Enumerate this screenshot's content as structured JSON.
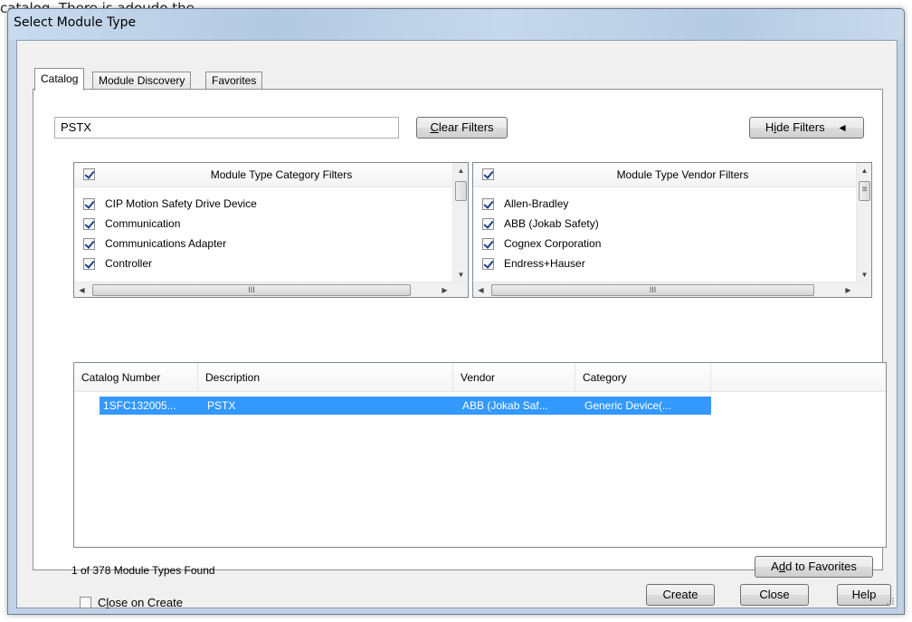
{
  "background_text": "catalog. There is adoudo the.",
  "window": {
    "title": "Select Module Type"
  },
  "tabs": [
    {
      "label": "Catalog",
      "active": true
    },
    {
      "label": "Module Discovery",
      "active": false
    },
    {
      "label": "Favorites",
      "active": false
    }
  ],
  "search": {
    "value": "PSTX"
  },
  "buttons": {
    "clear_filters_u": "C",
    "clear_filters_rest": "lear Filters",
    "hide_filters_pre": "H",
    "hide_filters_u": "i",
    "hide_filters_rest": "de Filters",
    "hide_filters_icon": "»",
    "add_favorites_pre": "A",
    "add_favorites_u": "d",
    "add_favorites_rest": "d to Favorites",
    "create": "Create",
    "close": "Close",
    "help": "Help"
  },
  "category_filters": {
    "header": "Module Type Category Filters",
    "items": [
      {
        "label": "CIP Motion Safety Drive Device",
        "checked": true
      },
      {
        "label": "Communication",
        "checked": true
      },
      {
        "label": "Communications Adapter",
        "checked": true
      },
      {
        "label": "Controller",
        "checked": true
      }
    ]
  },
  "vendor_filters": {
    "header": "Module Type Vendor Filters",
    "items": [
      {
        "label": "Allen-Bradley",
        "checked": true
      },
      {
        "label": "ABB (Jokab Safety)",
        "checked": true
      },
      {
        "label": "Cognex Corporation",
        "checked": true
      },
      {
        "label": "Endress+Hauser",
        "checked": true
      }
    ]
  },
  "scroll_glyphs": {
    "up": "▲",
    "down": "▼",
    "left": "◀",
    "right": "▶",
    "thumb_h": "III",
    "thumb_v": "≡"
  },
  "results": {
    "columns": [
      "Catalog Number",
      "Description",
      "Vendor",
      "Category"
    ],
    "rows": [
      {
        "catalog": "1SFC132005...",
        "description": "PSTX",
        "vendor": "ABB (Jokab Saf...",
        "category": "Generic Device(...",
        "selected": true
      }
    ]
  },
  "status": "1 of 378 Module Types Found",
  "close_on_create": {
    "pre": "C",
    "u": "l",
    "rest": "ose on Create",
    "checked": false
  },
  "colors": {
    "selection": "#3399ff",
    "panel": "#f0f0f0",
    "titlebar": "#c4d5e8"
  }
}
